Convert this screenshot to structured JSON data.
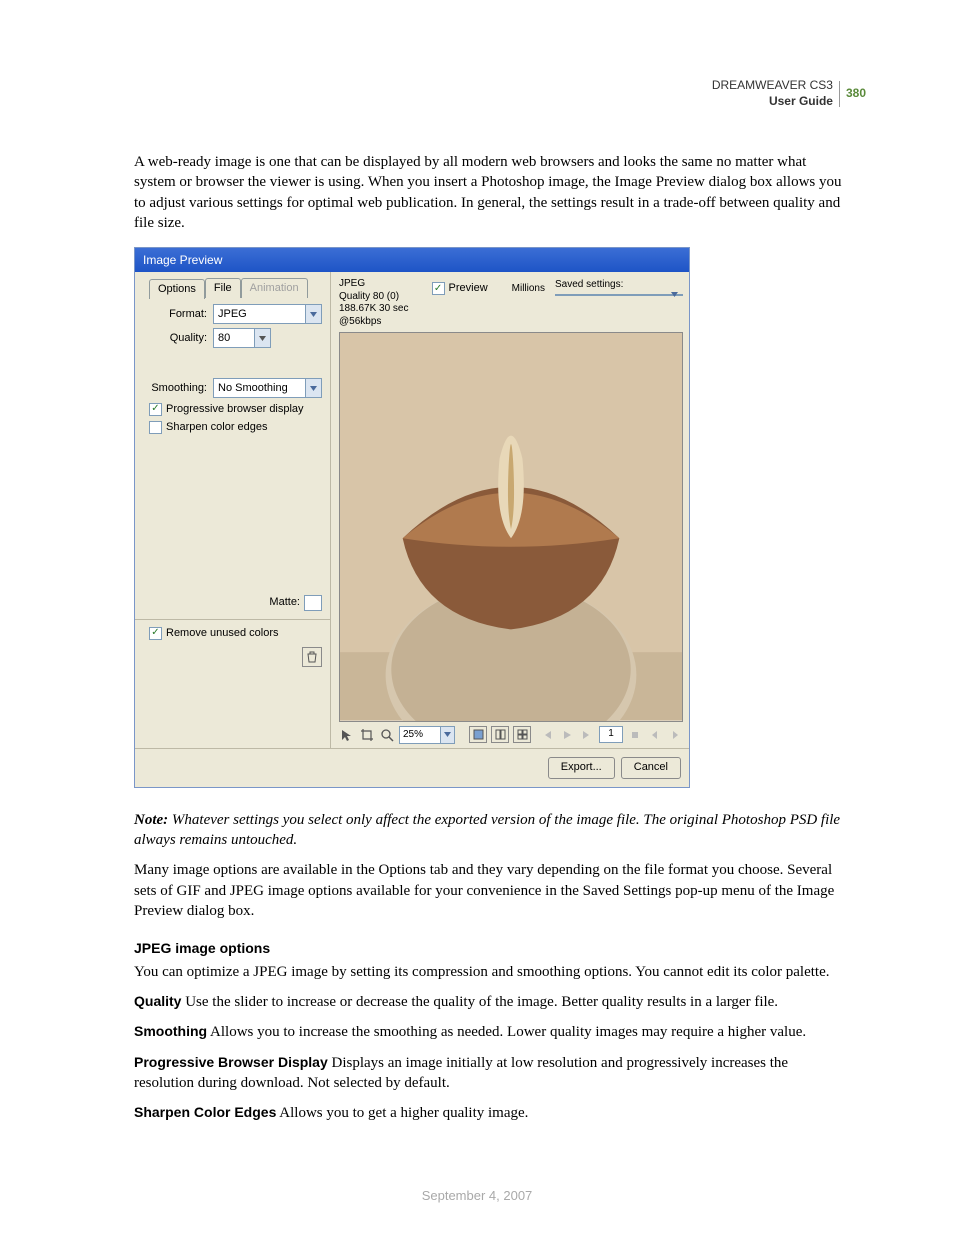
{
  "header": {
    "product": "DREAMWEAVER CS3",
    "guide": "User Guide",
    "page": "380"
  },
  "intro": "A web-ready image is one that can be displayed by all modern web browsers and looks the same no matter what system or browser the viewer is using. When you insert a Photoshop image, the Image Preview dialog box allows you to adjust various settings for optimal web publication. In general, the settings result in a trade-off between quality and file size.",
  "dialog": {
    "title": "Image Preview",
    "tabs": {
      "options": "Options",
      "file": "File",
      "animation": "Animation"
    },
    "format_label": "Format:",
    "format_value": "JPEG",
    "quality_label": "Quality:",
    "quality_value": "80",
    "smoothing_label": "Smoothing:",
    "smoothing_value": "No Smoothing",
    "progressive": "Progressive browser display",
    "sharpen": "Sharpen color edges",
    "matte": "Matte:",
    "remove": "Remove unused colors",
    "info": {
      "format": "JPEG",
      "quality": "Quality 80 (0)",
      "colors": "Millions",
      "size": "188.67K  30 sec @56kbps"
    },
    "preview_chk": "Preview",
    "saved_label": "Saved settings:",
    "zoom": "25%",
    "page": "1",
    "export": "Export...",
    "cancel": "Cancel"
  },
  "note": {
    "lead": "Note:",
    "body": " Whatever settings you select only affect the exported version of the image file. The original Photoshop PSD file always remains untouched."
  },
  "para2": "Many image options are available in the Options tab and they vary depending on the file format you choose. Several sets of GIF and JPEG image options available for your convenience in the Saved Settings pop-up menu of the Image Preview dialog box.",
  "section": {
    "title": "JPEG image options",
    "lead": "You can optimize a JPEG image by setting its compression and smoothing options. You cannot edit its color palette."
  },
  "opts": {
    "quality": {
      "t": "Quality",
      "d": "   Use the slider to increase or decrease the quality of the image. Better quality results in a larger file."
    },
    "smoothing": {
      "t": "Smoothing",
      "d": "   Allows you to increase the smoothing as needed. Lower quality images may require a higher value."
    },
    "progressive": {
      "t": "Progressive Browser Display",
      "d": "   Displays an image initially at low resolution and progressively increases the resolution during download. Not selected by default."
    },
    "sharpen": {
      "t": "Sharpen Color Edges",
      "d": "   Allows you to get a higher quality image."
    }
  },
  "date": "September 4, 2007"
}
